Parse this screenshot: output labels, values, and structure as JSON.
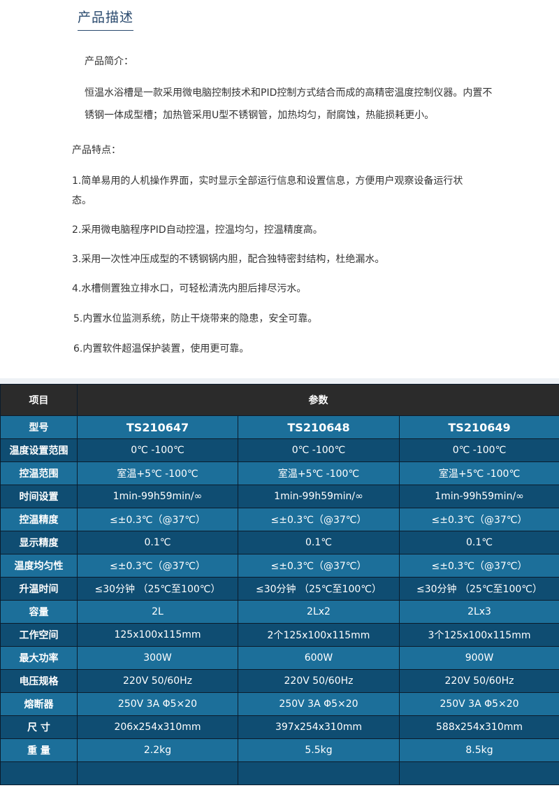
{
  "section_title": "产品描述",
  "intro": {
    "label": "产品简介：",
    "text": "恒温水浴槽是一款采用微电脑控制技术和PID控制方式结合而成的高精密温度控制仪器。内置不锈钢一体成型槽；加热管采用U型不锈钢管，加热均匀，耐腐蚀，热能损耗更小。"
  },
  "features": {
    "label": "产品特点：",
    "items": [
      "1.简单易用的人机操作界面，实时显示全部运行信息和设置信息，方便用户观察设备运行状态。",
      "2.采用微电脑程序PID自动控温，控温均匀，控温精度高。",
      "3.采用一次性冲压成型的不锈钢锅内胆，配合独特密封结构，杜绝漏水。",
      "4.水槽侧置独立排水口，可轻松清洗内胆后排尽污水。",
      "5.内置水位监测系统，防止干烧带来的隐患，安全可靠。",
      "6.内置软件超温保护装置，使用更可靠。"
    ]
  },
  "table": {
    "header": {
      "item": "项目",
      "params": "参数"
    },
    "rows": [
      {
        "label": "型号",
        "values": [
          "TS210647",
          "TS210648",
          "TS210649"
        ]
      },
      {
        "label": "温度设置范围",
        "values": [
          "0℃ -100℃",
          "0℃ -100℃",
          "0℃ -100℃"
        ]
      },
      {
        "label": "控温范围",
        "values": [
          "室温+5℃ -100℃",
          "室温+5℃ -100℃",
          "室温+5℃ -100℃"
        ]
      },
      {
        "label": "时间设置",
        "values": [
          "1min-99h59min/∞",
          "1min-99h59min/∞",
          "1min-99h59min/∞"
        ]
      },
      {
        "label": "控温精度",
        "values": [
          "≤±0.3℃（@37℃）",
          "≤±0.3℃（@37℃）",
          "≤±0.3℃（@37℃）"
        ]
      },
      {
        "label": "显示精度",
        "values": [
          "0.1℃",
          "0.1℃",
          "0.1℃"
        ]
      },
      {
        "label": "温度均匀性",
        "values": [
          "≤±0.3℃（@37℃）",
          "≤±0.3℃（@37℃）",
          "≤±0.3℃（@37℃）"
        ]
      },
      {
        "label": "升温时间",
        "values": [
          "≤30分钟 （25℃至100℃）",
          "≤30分钟 （25℃至100℃）",
          "≤30分钟 （25℃至100℃）"
        ]
      },
      {
        "label": "容量",
        "values": [
          "2L",
          "2Lx2",
          "2Lx3"
        ]
      },
      {
        "label": "工作空间",
        "values": [
          "125x100x115mm",
          "2个125x100x115mm",
          "3个125x100x115mm"
        ]
      },
      {
        "label": "最大功率",
        "values": [
          "300W",
          "600W",
          "900W"
        ]
      },
      {
        "label": "电压规格",
        "values": [
          "220V 50/60Hz",
          "220V 50/60Hz",
          "220V 50/60Hz"
        ]
      },
      {
        "label": "熔断器",
        "values": [
          "250V 3A Φ5×20",
          "250V 3A Φ5×20",
          "250V 3A Φ5×20"
        ]
      },
      {
        "label": "尺 寸",
        "values": [
          "206x254x310mm",
          "397x254x310mm",
          "588x254x310mm"
        ]
      },
      {
        "label": "重 量",
        "values": [
          "2.2kg",
          "5.5kg",
          "8.5kg"
        ]
      }
    ]
  },
  "colors": {
    "title": "#2a4a6e",
    "header_bg": "#2b2b2b",
    "row_light": "#1c6f9a",
    "row_dark": "#0f4d72"
  }
}
